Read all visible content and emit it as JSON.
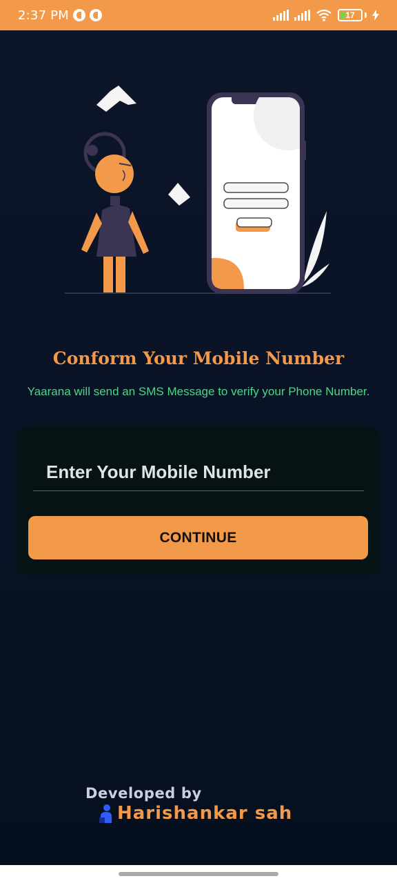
{
  "status_bar": {
    "time": "2:37 PM",
    "battery_level": "17",
    "icons": [
      "notification-icon",
      "notification-icon",
      "signal-icon",
      "signal-icon",
      "wifi-icon",
      "battery-icon",
      "charging-icon"
    ]
  },
  "colors": {
    "accent": "#f2994a",
    "background": "#0b1422",
    "card": "#071214",
    "subtitle": "#4ed48a"
  },
  "illustration": {
    "icon": "phone-login-illustration"
  },
  "header": {
    "title": "Conform Your Mobile Number",
    "subtitle": "Yaarana will send an SMS Message to verify your Phone Number."
  },
  "form": {
    "phone_placeholder": "Enter Your Mobile Number",
    "phone_value": "",
    "continue_label": "CONTINUE"
  },
  "footer": {
    "developed_by": "Developed by",
    "developer_name": "Harishankar sah"
  }
}
